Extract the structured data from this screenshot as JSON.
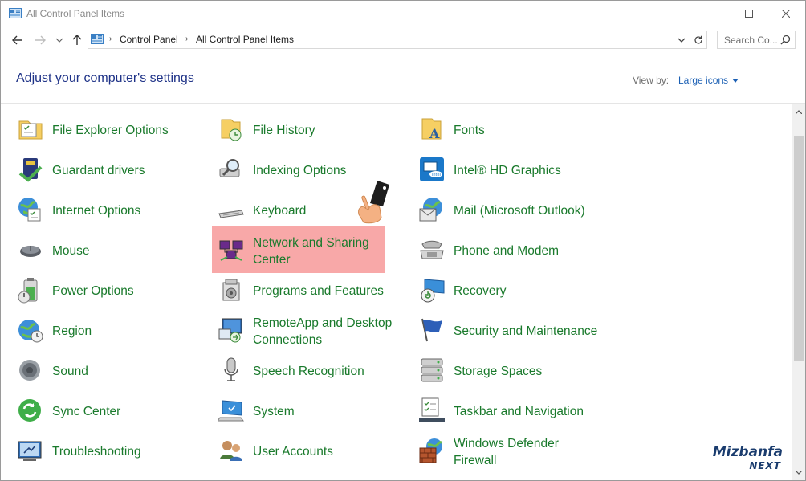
{
  "window": {
    "title": "All Control Panel Items"
  },
  "address": {
    "crumbs": [
      "Control Panel",
      "All Control Panel Items"
    ]
  },
  "search": {
    "placeholder": "Search Co..."
  },
  "header": {
    "title": "Adjust your computer's settings",
    "view_by_label": "View by:",
    "view_by_value": "Large icons"
  },
  "items": [
    {
      "label": "File Explorer Options",
      "icon": "folder-options-icon"
    },
    {
      "label": "Guardant drivers",
      "icon": "guardant-icon"
    },
    {
      "label": "Internet Options",
      "icon": "internet-options-icon"
    },
    {
      "label": "Mouse",
      "icon": "mouse-icon"
    },
    {
      "label": "Power Options",
      "icon": "power-options-icon"
    },
    {
      "label": "Region",
      "icon": "region-icon"
    },
    {
      "label": "Sound",
      "icon": "sound-icon"
    },
    {
      "label": "Sync Center",
      "icon": "sync-icon"
    },
    {
      "label": "Troubleshooting",
      "icon": "troubleshooting-icon"
    },
    {
      "label": "File History",
      "icon": "file-history-icon"
    },
    {
      "label": "Indexing Options",
      "icon": "indexing-icon"
    },
    {
      "label": "Keyboard",
      "icon": "keyboard-icon"
    },
    {
      "label": "Network and Sharing\nCenter",
      "icon": "network-icon"
    },
    {
      "label": "Programs and Features",
      "icon": "programs-icon"
    },
    {
      "label": "RemoteApp and Desktop\nConnections",
      "icon": "remoteapp-icon"
    },
    {
      "label": "Speech Recognition",
      "icon": "microphone-icon"
    },
    {
      "label": "System",
      "icon": "system-icon"
    },
    {
      "label": "User Accounts",
      "icon": "user-accounts-icon"
    },
    {
      "label": "Fonts",
      "icon": "fonts-icon"
    },
    {
      "label": "Intel® HD Graphics",
      "icon": "intel-graphics-icon"
    },
    {
      "label": "Mail (Microsoft Outlook)",
      "icon": "mail-icon"
    },
    {
      "label": "Phone and Modem",
      "icon": "phone-icon"
    },
    {
      "label": "Recovery",
      "icon": "recovery-icon"
    },
    {
      "label": "Security and Maintenance",
      "icon": "flag-icon"
    },
    {
      "label": "Storage Spaces",
      "icon": "storage-icon"
    },
    {
      "label": "Taskbar and Navigation",
      "icon": "taskbar-icon"
    },
    {
      "label": "Windows Defender\nFirewall",
      "icon": "firewall-icon"
    }
  ],
  "watermark": {
    "top": "Mizbanfa",
    "bottom": "NEXT"
  },
  "colors": {
    "item_text": "#1a7a2c",
    "title_text": "#1e3287",
    "link": "#1a5fb4",
    "highlight": "#f8a8a8"
  }
}
